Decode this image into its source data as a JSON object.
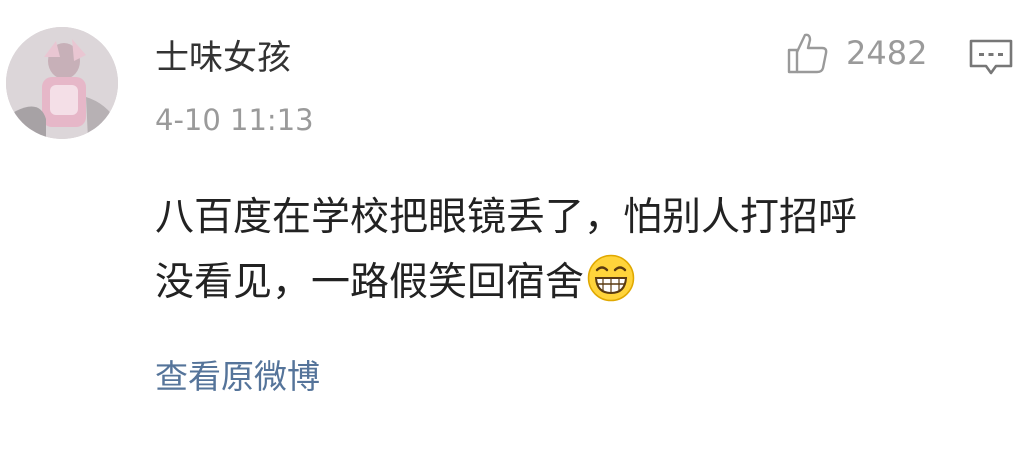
{
  "comment": {
    "author": "士味女孩",
    "timestamp": "4-10 11:13",
    "like_count": "2482",
    "text_line_1": "八百度在学校把眼镜丢了，怕别人打招呼",
    "text_line_2": "没看见，一路假笑回宿舍",
    "emoji": "grinning-face-emoji",
    "view_original_label": "查看原微博"
  },
  "icons": {
    "like": "thumbs-up-icon",
    "comment": "comment-bubble-icon"
  },
  "colors": {
    "author": "#333333",
    "muted": "#9a9a9a",
    "body_text": "#222222",
    "link": "#55749a",
    "emoji_face": "#ffd43b"
  }
}
